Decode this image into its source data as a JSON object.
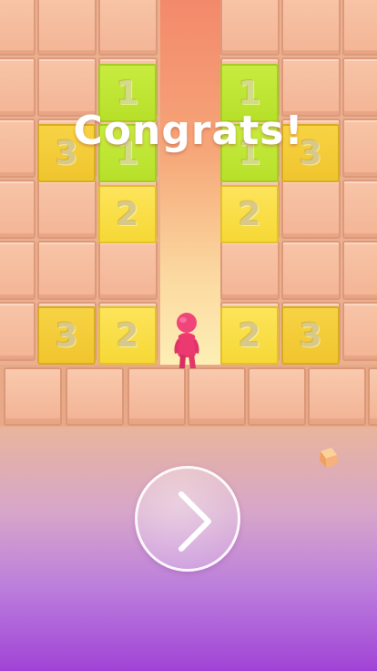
{
  "game": {
    "congrats_text": "Congrats!",
    "next_button_icon": "chevron-right-icon"
  },
  "tiles": {
    "left_top_1": "1",
    "left_mid_1": "1",
    "left_three_top": "3",
    "left_two_mid": "2",
    "left_three_bottom": "3",
    "left_two_bottom": "2",
    "right_top_1": "1",
    "right_mid_1": "1",
    "right_three_top": "3",
    "right_two_mid": "2",
    "right_two_bottom": "2",
    "right_three_bottom": "3"
  },
  "colors": {
    "tile_one": "#c7ec3f",
    "tile_two": "#fde45b",
    "tile_three": "#f7d344",
    "character": "#f0457a",
    "background_bottom": "#a043d6"
  }
}
